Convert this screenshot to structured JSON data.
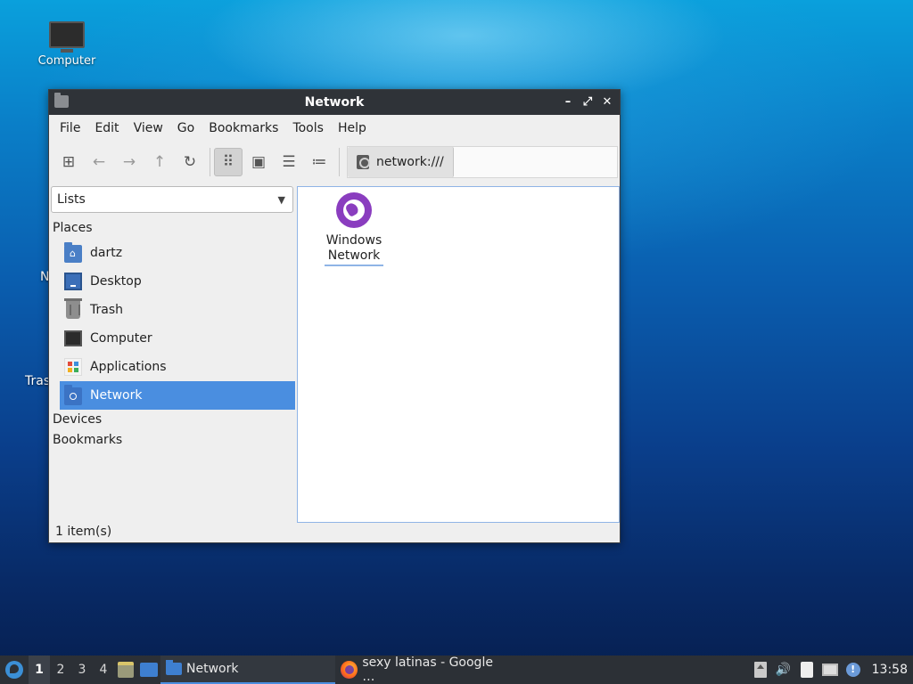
{
  "desktop": {
    "computer_label": "Computer",
    "partial_label_1": "N",
    "partial_label_2": "Tras"
  },
  "window": {
    "title": "Network",
    "controls": {
      "minimize": "–",
      "maximize": "⤢",
      "close": "✕"
    }
  },
  "menu": [
    "File",
    "Edit",
    "View",
    "Go",
    "Bookmarks",
    "Tools",
    "Help"
  ],
  "toolbar": {
    "buttons": [
      {
        "icon": "new-window-icon",
        "glyph": "⊞"
      },
      {
        "icon": "back-arrow-icon",
        "glyph": "←"
      },
      {
        "icon": "forward-arrow-icon",
        "glyph": "→"
      },
      {
        "icon": "up-arrow-icon",
        "glyph": "↑"
      },
      {
        "icon": "reload-icon",
        "glyph": "↻"
      }
    ],
    "view_buttons": [
      {
        "icon": "icon-view-icon",
        "glyph": "⠿",
        "active": true
      },
      {
        "icon": "thumbnail-view-icon",
        "glyph": "▣",
        "active": false
      },
      {
        "icon": "compact-view-icon",
        "glyph": "☰",
        "active": false
      },
      {
        "icon": "detailed-list-view-icon",
        "glyph": "≔",
        "active": false
      }
    ],
    "location": "network:///"
  },
  "sidepane": {
    "mode_select": "Lists",
    "sections": {
      "places": "Places",
      "devices": "Devices",
      "bookmarks": "Bookmarks"
    },
    "places": [
      {
        "label": "dartz",
        "icon": "home-folder-icon",
        "selected": false
      },
      {
        "label": "Desktop",
        "icon": "desktop-icon",
        "selected": false
      },
      {
        "label": "Trash",
        "icon": "trash-icon",
        "selected": false
      },
      {
        "label": "Computer",
        "icon": "computer-icon",
        "selected": false
      },
      {
        "label": "Applications",
        "icon": "applications-icon",
        "selected": false
      },
      {
        "label": "Network",
        "icon": "network-folder-icon",
        "selected": true
      }
    ]
  },
  "content": {
    "items": [
      {
        "name_line1": "Windows",
        "name_line2": "Network",
        "icon": "windows-network-globe-icon"
      }
    ]
  },
  "status": {
    "text": "1 item(s)"
  },
  "taskbar": {
    "workspaces": [
      "1",
      "2",
      "3",
      "4"
    ],
    "active_workspace": "1",
    "tasks": [
      {
        "label": "Network",
        "icon": "folder-icon",
        "active": true
      },
      {
        "label": "sexy latinas - Google …",
        "icon": "firefox-icon",
        "active": false
      }
    ],
    "tray": {
      "volume_glyph": "🔊",
      "update_glyph": "!"
    },
    "clock": "13:58"
  }
}
